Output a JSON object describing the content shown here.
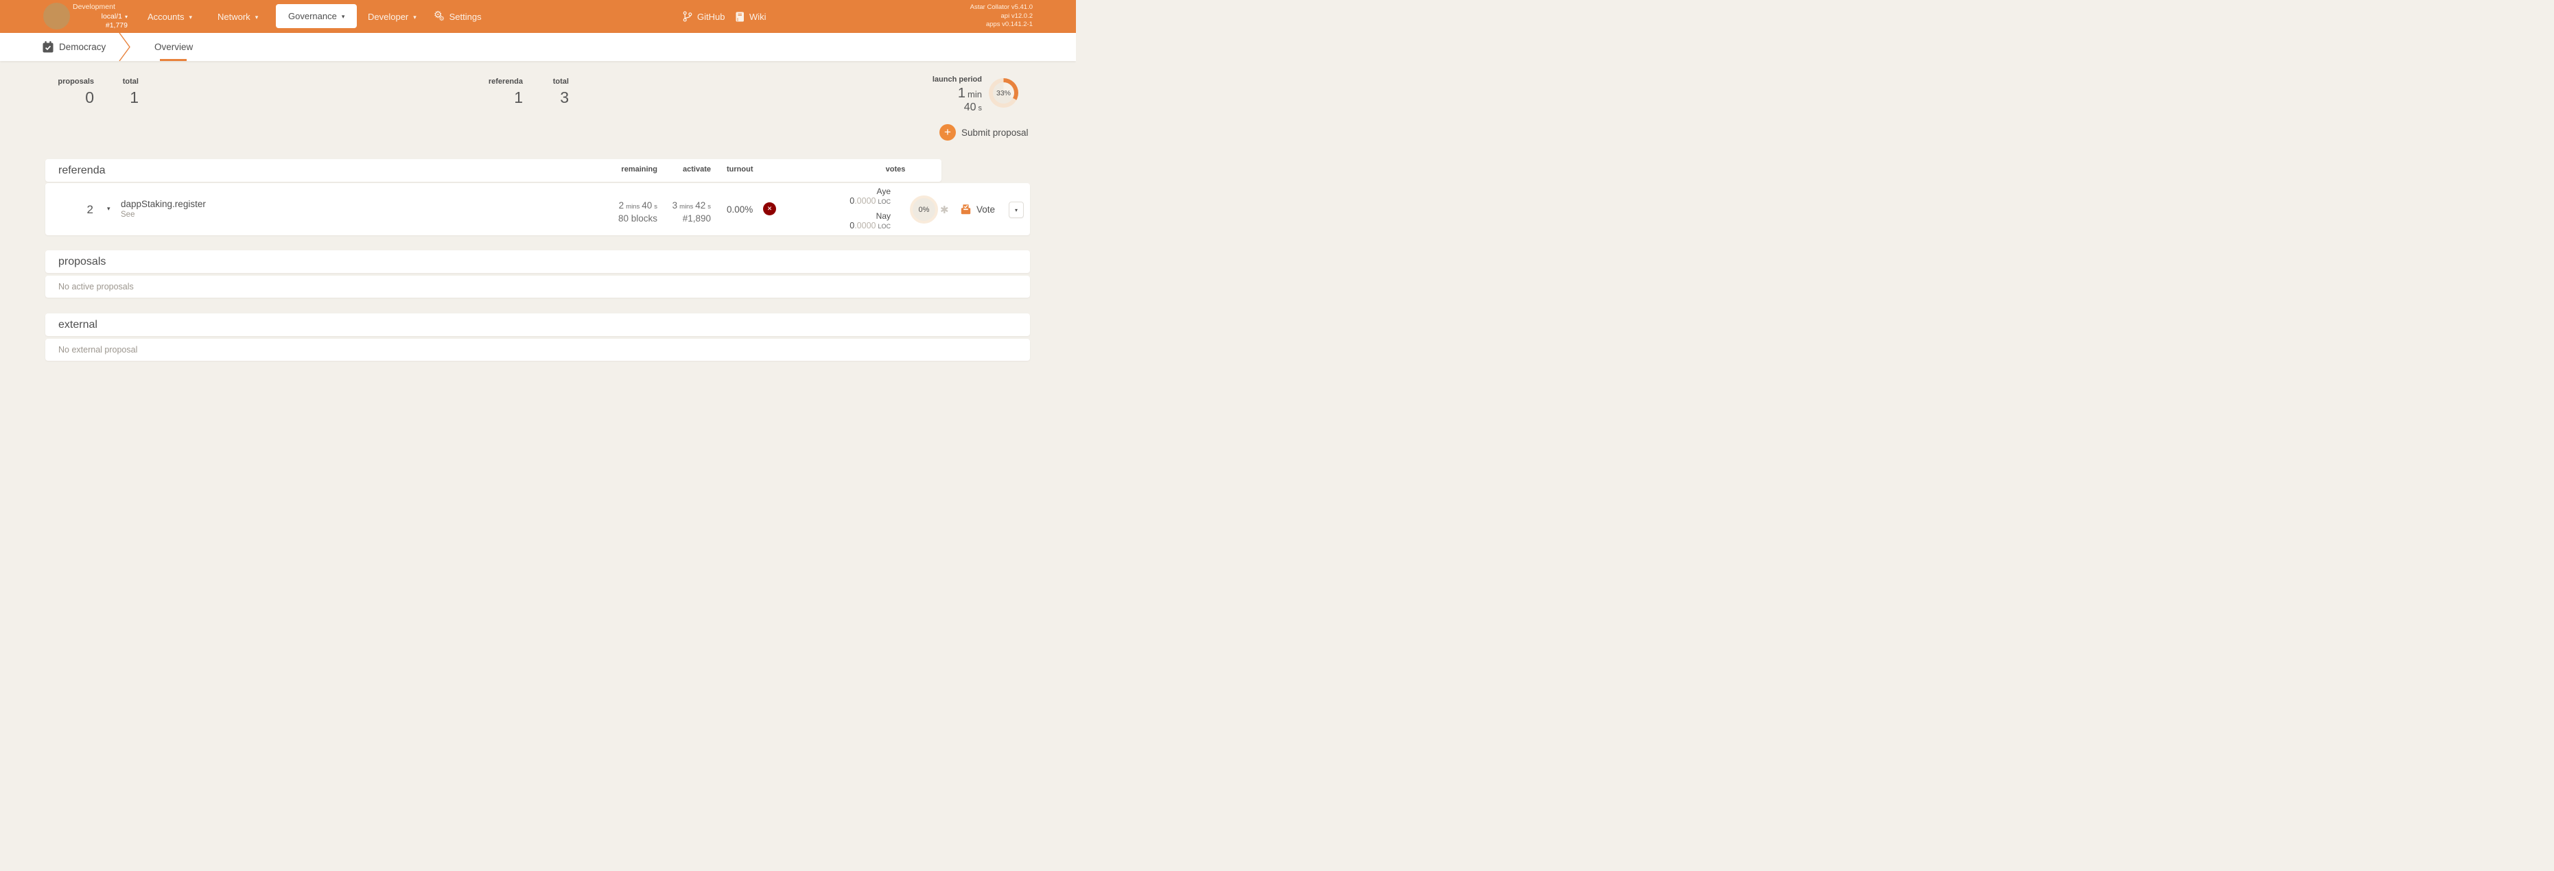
{
  "navbar": {
    "network": "Development",
    "endpoint": "local/1",
    "best_block": "#1,779",
    "items": [
      {
        "label": "Accounts"
      },
      {
        "label": "Network"
      },
      {
        "label": "Governance",
        "active": true
      },
      {
        "label": "Developer"
      },
      {
        "label": "Settings"
      }
    ],
    "links": [
      {
        "label": "GitHub"
      },
      {
        "label": "Wiki"
      }
    ],
    "version_lines": [
      "Astar Collator v5.41.0",
      "api v12.0.2",
      "apps v0.141.2-1"
    ]
  },
  "tabbar": {
    "section": "Democracy",
    "active_tab": "Overview"
  },
  "summary": {
    "proposals": {
      "label": "proposals",
      "value": "0"
    },
    "proposals_total": {
      "label": "total",
      "value": "1"
    },
    "referenda": {
      "label": "referenda",
      "value": "1"
    },
    "referenda_total": {
      "label": "total",
      "value": "3"
    },
    "launch_period": {
      "label": "launch period",
      "value_min": "1",
      "unit_min": "min",
      "value_s": "40",
      "unit_s": "s",
      "progress": "33%"
    }
  },
  "actions": {
    "submit_proposal": "Submit proposal"
  },
  "referenda_table": {
    "title": "referenda",
    "columns": {
      "remaining": "remaining",
      "activate": "activate",
      "turnout": "turnout",
      "votes": "votes"
    },
    "row": {
      "id": "2",
      "proposal": "dappStaking.register",
      "proposal_sub": "See",
      "remaining": {
        "v1": "2",
        "u1": "mins",
        "v2": "40",
        "u2": "s",
        "blocks": "80 blocks"
      },
      "activate": {
        "v1": "3",
        "u1": "mins",
        "v2": "42",
        "u2": "s",
        "block": "#1,890"
      },
      "turnout": "0.00%",
      "votes": {
        "aye_label": "Aye",
        "aye_int": "0",
        "aye_frac": ".0000",
        "aye_unit": "LOC",
        "nay_label": "Nay",
        "nay_int": "0",
        "nay_frac": ".0000",
        "nay_unit": "LOC"
      },
      "approval": "0%",
      "vote_button": "Vote"
    }
  },
  "proposals_table": {
    "title": "proposals",
    "empty": "No active proposals"
  },
  "external_table": {
    "title": "external",
    "empty": "No external proposal"
  },
  "icons": {
    "caret": "▾",
    "plus": "+",
    "close": "✕",
    "asterisk": "✱"
  },
  "colors": {
    "accent": "#e8823c",
    "navbar": "#e7813b",
    "fail": "#8e0000",
    "page_bg": "#f3f0ea"
  }
}
